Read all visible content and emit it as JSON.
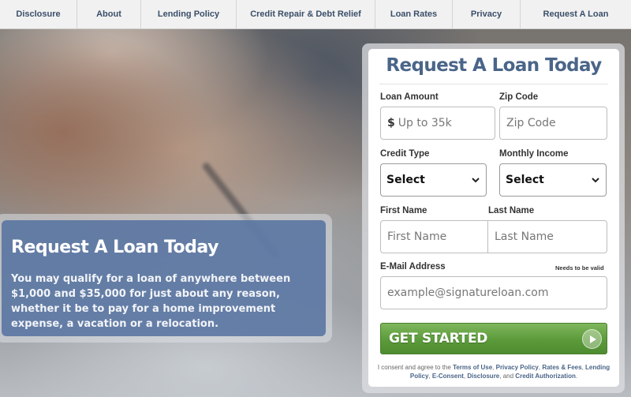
{
  "nav": {
    "items": [
      {
        "label": "Disclosure",
        "width": 98
      },
      {
        "label": "About",
        "width": 81
      },
      {
        "label": "Lending Policy",
        "width": 121
      },
      {
        "label": "Credit Repair & Debt Relief",
        "width": 176
      },
      {
        "label": "Loan Rates",
        "width": 98
      },
      {
        "label": "Privacy",
        "width": 86
      },
      {
        "label": "Request A Loan",
        "width": 140
      }
    ]
  },
  "hero": {
    "title": "Request A Loan Today",
    "text": "You may qualify for a loan of anywhere between $1,000 and $35,000 for just about any reason, whether it be to pay for a home improvement expense, a vacation or a relocation."
  },
  "form": {
    "title": "Request A Loan Today",
    "loan_amount_label": "Loan Amount",
    "loan_amount_prefix": "$",
    "loan_amount_placeholder": "Up to 35k",
    "zip_label": "Zip Code",
    "zip_placeholder": "Zip Code",
    "credit_type_label": "Credit Type",
    "credit_type_value": "Select",
    "monthly_income_label": "Monthly Income",
    "monthly_income_value": "Select",
    "first_name_label": "First Name",
    "first_name_placeholder": "First Name",
    "last_name_label": "Last Name",
    "last_name_placeholder": "Last Name",
    "email_label": "E-Mail Address",
    "email_note": "Needs to be valid",
    "email_placeholder": "example@signatureloan.com",
    "submit_label": "GET STARTED",
    "consent_prefix": "I consent and agree to the",
    "consent_links": {
      "terms": "Terms of Use",
      "privacy": "Privacy Policy",
      "rates": "Rates & Fees",
      "lending": "Lending Policy",
      "econsent": "E-Consent",
      "disclosure": "Disclosure",
      "credit": "Credit Authorization"
    },
    "consent_and": "and"
  },
  "colors": {
    "nav_text": "#3a4f6a",
    "title_blue": "#4a6588",
    "button_green": "#5b9a3a",
    "info_box": "#5673a0"
  }
}
